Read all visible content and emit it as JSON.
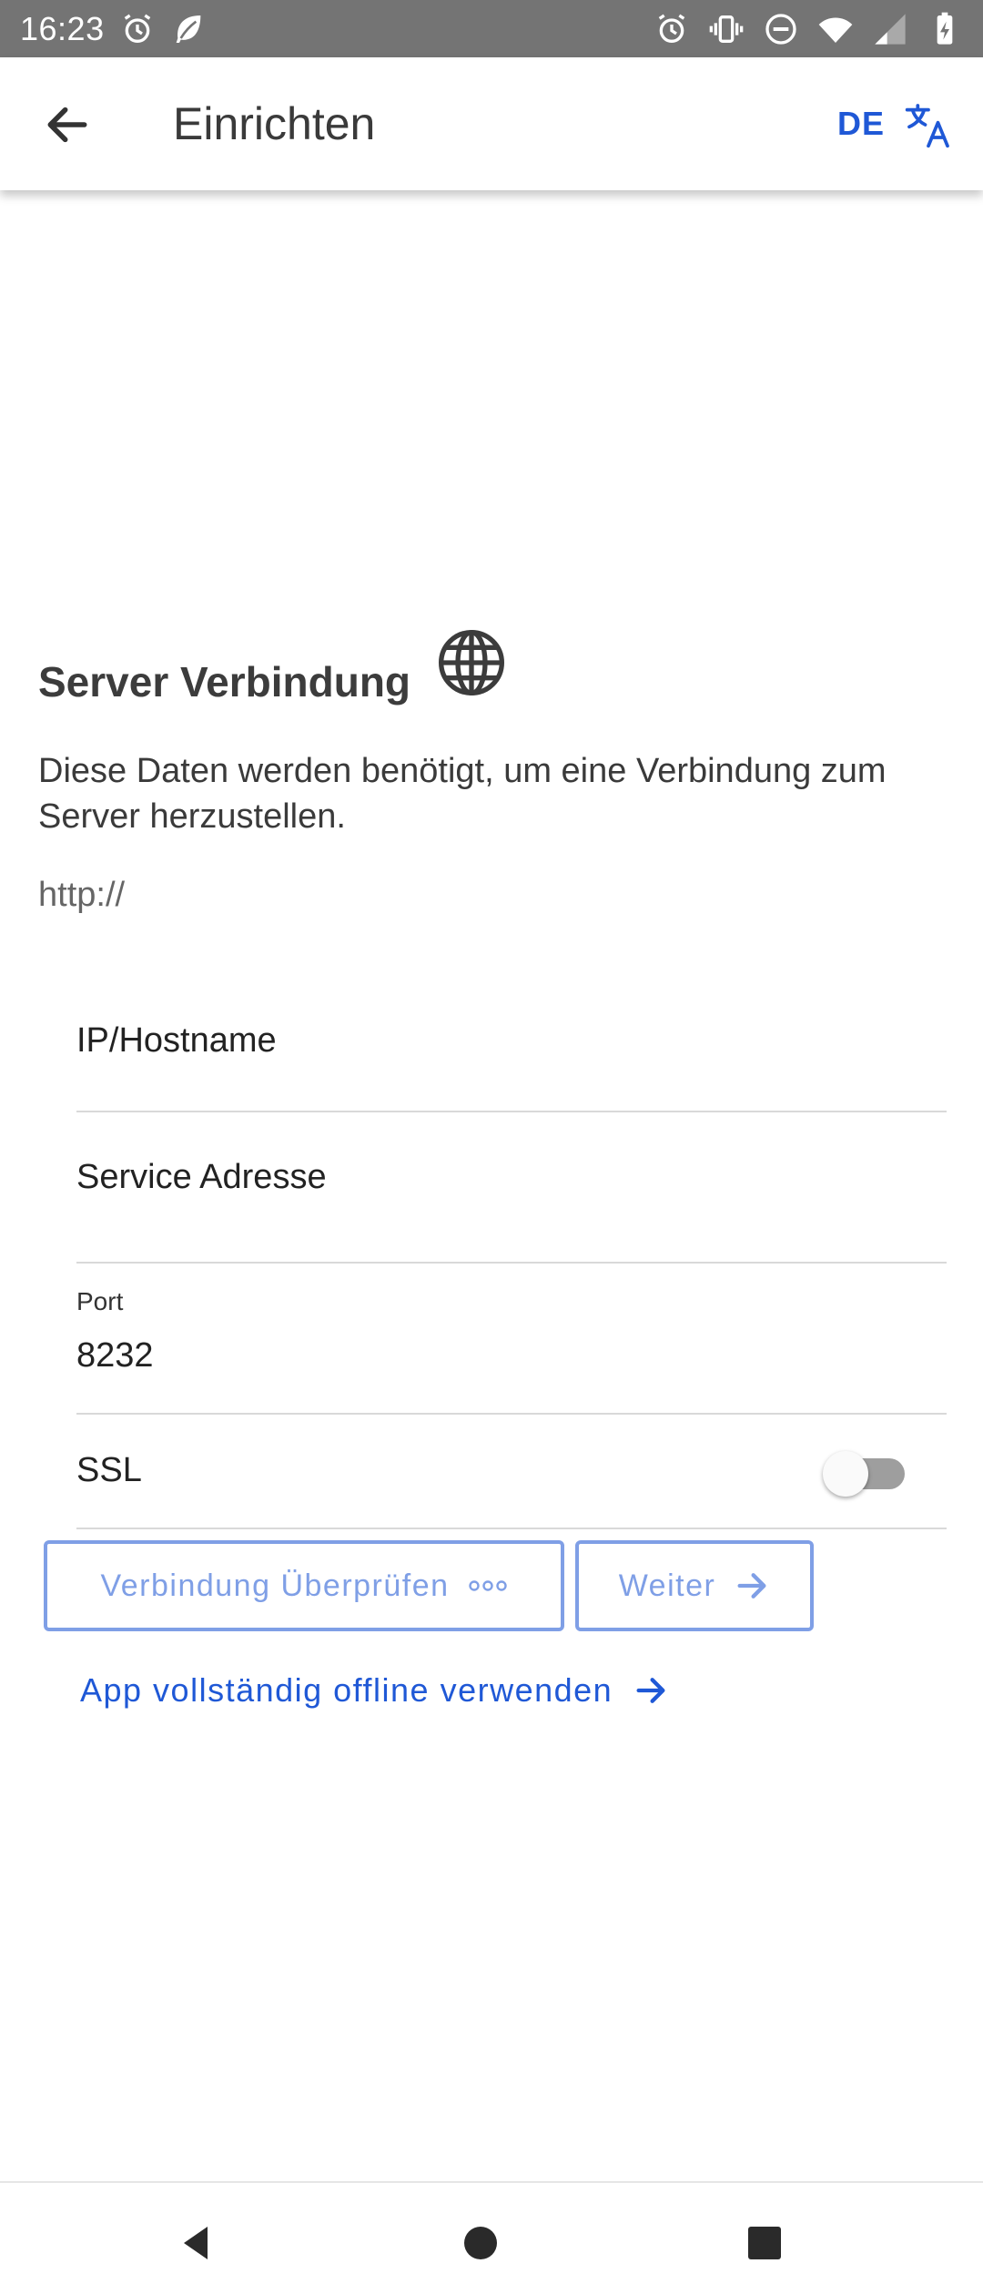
{
  "status_bar": {
    "time": "16:23",
    "left_icons": [
      "alarm-icon",
      "leaf-icon"
    ],
    "right_icons": [
      "alarm-icon",
      "vibrate-icon",
      "do-not-disturb-icon",
      "wifi-icon",
      "signal-icon",
      "battery-charging-icon"
    ]
  },
  "app_bar": {
    "title": "Einrichten",
    "language_code": "DE",
    "back_icon": "arrow-back-icon",
    "translate_icon": "translate-icon"
  },
  "section": {
    "title": "Server Verbindung",
    "icon": "globe-icon",
    "description": "Diese Daten werden benötigt, um eine Verbindung zum Server herzustellen.",
    "protocol": "http://"
  },
  "form": {
    "hostname": {
      "placeholder": "IP/Hostname",
      "value": ""
    },
    "service_address": {
      "placeholder": "Service Adresse",
      "value": ""
    },
    "port": {
      "label": "Port",
      "value": "8232"
    },
    "ssl": {
      "label": "SSL",
      "enabled": false
    }
  },
  "actions": {
    "verify_label": "Verbindung Überprüfen",
    "next_label": "Weiter",
    "offline_label": "App vollständig offline verwenden"
  },
  "colors": {
    "accent": "#1f58d6",
    "disabled_accent": "#7f9fe6",
    "status_bar": "#747474",
    "text": "#3c3c3c"
  },
  "nav_bar": {
    "icons": [
      "nav-back-icon",
      "nav-home-icon",
      "nav-recents-icon"
    ]
  }
}
